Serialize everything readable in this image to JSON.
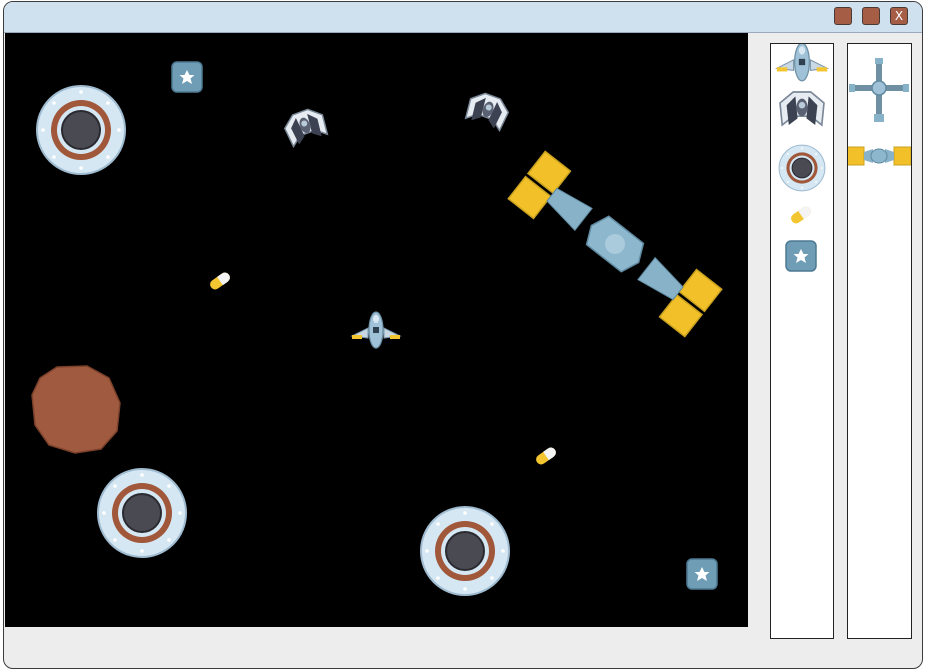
{
  "window": {
    "title": "",
    "buttons": {
      "minimize": "",
      "maximize": "",
      "close": "X"
    }
  },
  "game": {
    "background_color": "#000000",
    "entities": [
      {
        "kind": "player-ship"
      },
      {
        "kind": "enemy-fighter"
      },
      {
        "kind": "enemy-fighter"
      },
      {
        "kind": "space-station"
      },
      {
        "kind": "space-station"
      },
      {
        "kind": "space-station"
      },
      {
        "kind": "satellite"
      },
      {
        "kind": "asteroid"
      },
      {
        "kind": "capsule-pill"
      },
      {
        "kind": "capsule-pill"
      },
      {
        "kind": "star-powerup"
      },
      {
        "kind": "star-powerup"
      }
    ]
  },
  "palettes": {
    "sprites": [
      "player-ship",
      "enemy-fighter",
      "space-station",
      "capsule-pill",
      "star-powerup"
    ],
    "structures": [
      "cross-satellite",
      "solar-satellite"
    ]
  },
  "colors": {
    "titlebar": "#cfe0ef",
    "window_button": "#a55d45",
    "station_ring": "#d5e7f3",
    "station_band": "#a0573a",
    "solar_panel": "#f2c029",
    "ship_body": "#9fc2d8",
    "asteroid": "#a05a40"
  }
}
